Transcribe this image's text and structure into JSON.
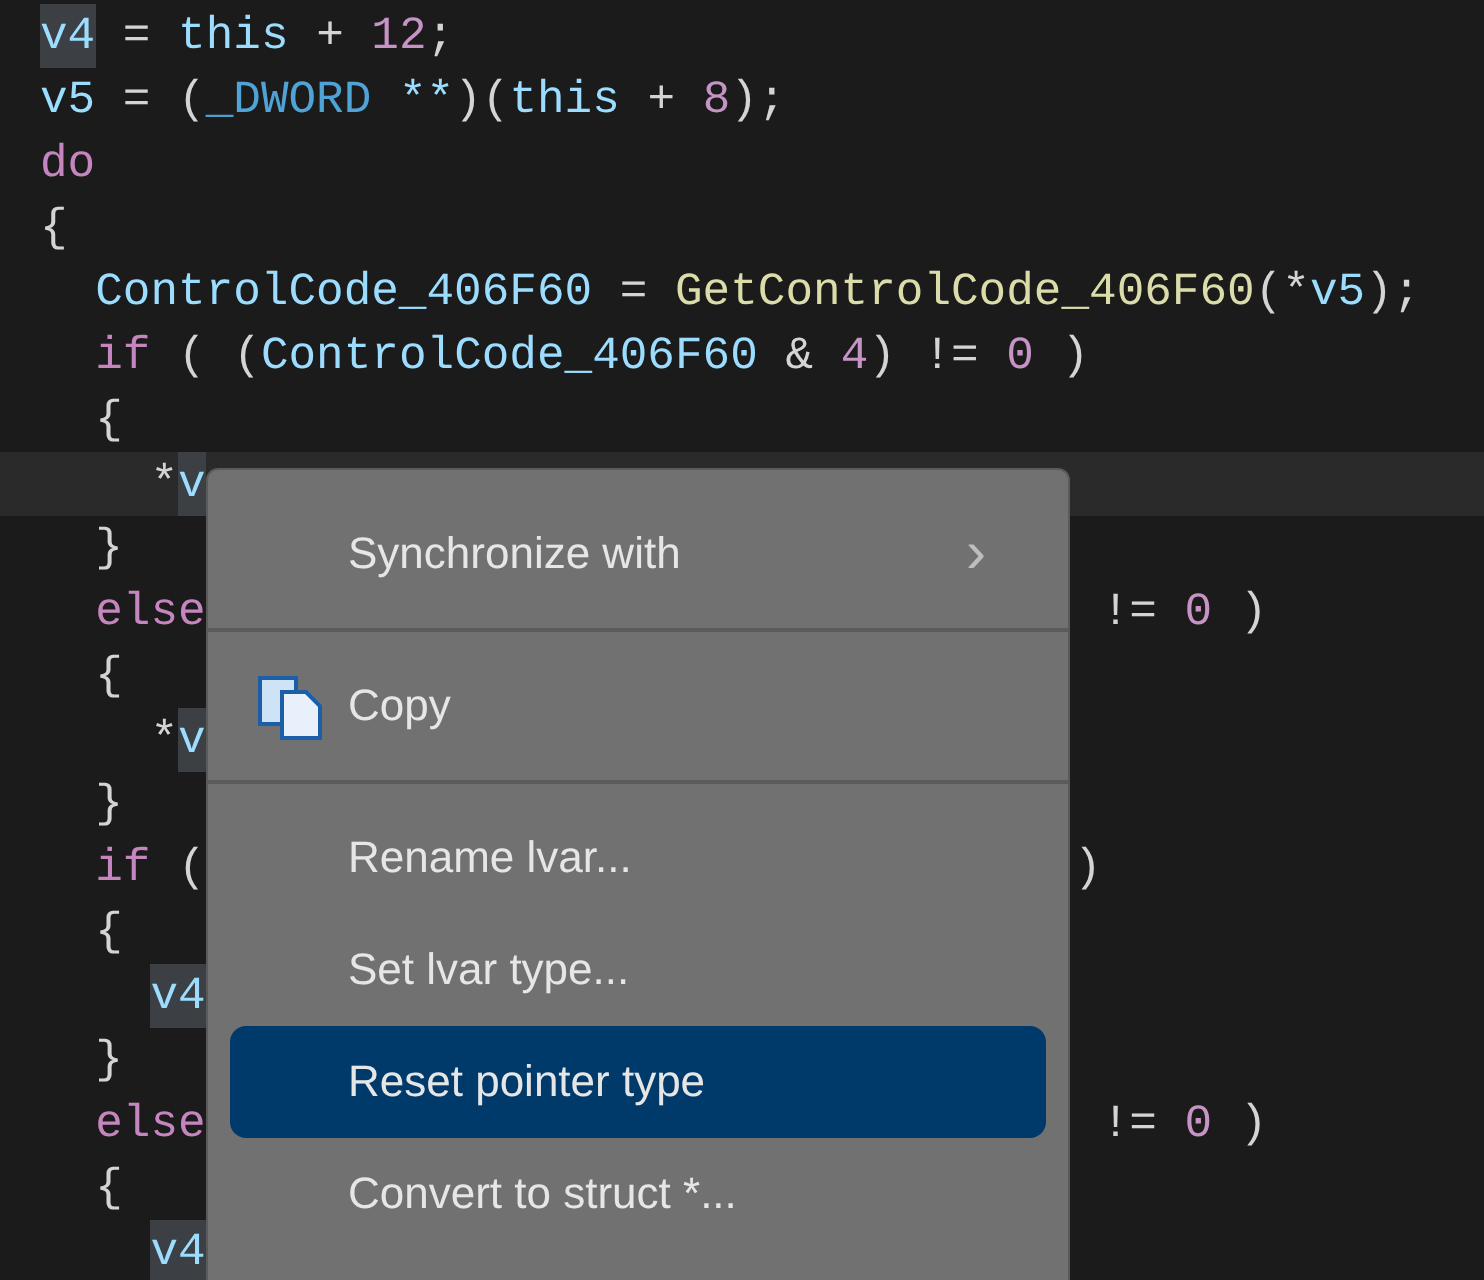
{
  "code_lines": [
    {
      "current": false,
      "before": [
        {
          "t": "v4",
          "kind": "ident",
          "highlighted": true
        },
        {
          "t": " = ",
          "kind": "punct"
        },
        {
          "t": "this",
          "kind": "ident"
        },
        {
          "t": " + ",
          "kind": "punct"
        },
        {
          "t": "12",
          "kind": "num"
        },
        {
          "t": ";",
          "kind": "punct"
        }
      ]
    },
    {
      "current": false,
      "before": [
        {
          "t": "v5",
          "kind": "ident"
        },
        {
          "t": " = (",
          "kind": "punct"
        },
        {
          "t": "_DWORD",
          "kind": "type"
        },
        {
          "t": " **",
          "kind": "ident"
        },
        {
          "t": ")(",
          "kind": "punct"
        },
        {
          "t": "this",
          "kind": "ident"
        },
        {
          "t": " + ",
          "kind": "punct"
        },
        {
          "t": "8",
          "kind": "num"
        },
        {
          "t": ");",
          "kind": "punct"
        }
      ]
    },
    {
      "current": false,
      "before": [
        {
          "t": "do",
          "kind": "kw"
        }
      ]
    },
    {
      "current": false,
      "before": [
        {
          "t": "{",
          "kind": "punct"
        }
      ]
    },
    {
      "current": false,
      "before": [
        {
          "t": "  ControlCode_406F60",
          "kind": "ident"
        },
        {
          "t": " = ",
          "kind": "punct"
        },
        {
          "t": "GetControlCode_406F60",
          "kind": "func"
        },
        {
          "t": "(*",
          "kind": "punct"
        },
        {
          "t": "v5",
          "kind": "ident"
        },
        {
          "t": ");",
          "kind": "punct"
        }
      ]
    },
    {
      "current": false,
      "before": [
        {
          "t": "  if",
          "kind": "kw"
        },
        {
          "t": " ( (",
          "kind": "punct"
        },
        {
          "t": "ControlCode_406F60",
          "kind": "ident"
        },
        {
          "t": " & ",
          "kind": "punct"
        },
        {
          "t": "4",
          "kind": "num"
        },
        {
          "t": ") != ",
          "kind": "punct"
        },
        {
          "t": "0",
          "kind": "num"
        },
        {
          "t": " )",
          "kind": "punct"
        }
      ]
    },
    {
      "current": false,
      "before": [
        {
          "t": "  {",
          "kind": "punct"
        }
      ]
    },
    {
      "current": true,
      "before": [
        {
          "t": "    *",
          "kind": "punct"
        },
        {
          "t": "v",
          "kind": "ident",
          "highlighted": true
        }
      ]
    },
    {
      "current": false,
      "before": [
        {
          "t": "  }",
          "kind": "punct"
        }
      ]
    },
    {
      "current": false,
      "before": [
        {
          "t": "  else",
          "kind": "kw"
        }
      ],
      "after": [
        {
          "t": " != ",
          "kind": "punct"
        },
        {
          "t": "0",
          "kind": "num"
        },
        {
          "t": " )",
          "kind": "punct"
        }
      ]
    },
    {
      "current": false,
      "before": [
        {
          "t": "  {",
          "kind": "punct"
        }
      ]
    },
    {
      "current": false,
      "before": [
        {
          "t": "    *",
          "kind": "punct"
        },
        {
          "t": "v",
          "kind": "ident",
          "highlighted": true
        }
      ]
    },
    {
      "current": false,
      "before": [
        {
          "t": "  }",
          "kind": "punct"
        }
      ]
    },
    {
      "current": false,
      "before": [
        {
          "t": "  if",
          "kind": "kw"
        },
        {
          "t": " (",
          "kind": "punct"
        }
      ],
      "after": [
        {
          "t": ")",
          "kind": "punct"
        }
      ]
    },
    {
      "current": false,
      "before": [
        {
          "t": "  {",
          "kind": "punct"
        }
      ]
    },
    {
      "current": false,
      "before": [
        {
          "t": "    v4",
          "kind": "ident",
          "highlighted": true
        }
      ]
    },
    {
      "current": false,
      "before": [
        {
          "t": "  }",
          "kind": "punct"
        }
      ]
    },
    {
      "current": false,
      "before": [
        {
          "t": "  else",
          "kind": "kw"
        }
      ],
      "after": [
        {
          "t": " != ",
          "kind": "punct"
        },
        {
          "t": "0",
          "kind": "num"
        },
        {
          "t": " )",
          "kind": "punct"
        }
      ]
    },
    {
      "current": false,
      "before": [
        {
          "t": "  {",
          "kind": "punct"
        }
      ]
    },
    {
      "current": false,
      "before": [
        {
          "t": "    v4",
          "kind": "ident",
          "highlighted": true
        }
      ]
    }
  ],
  "context_menu": {
    "items": [
      {
        "kind": "submenu",
        "label": "Synchronize with",
        "arrow": "›",
        "selected": false
      },
      {
        "kind": "separator"
      },
      {
        "kind": "copy",
        "label": "Copy",
        "selected": false
      },
      {
        "kind": "separator"
      },
      {
        "kind": "plain",
        "label": "Rename lvar...",
        "selected": false
      },
      {
        "kind": "plain",
        "label": "Set lvar type...",
        "selected": false
      },
      {
        "kind": "plain",
        "label": "Reset pointer type",
        "selected": true
      },
      {
        "kind": "plain",
        "label": "Convert to struct *...",
        "selected": false
      }
    ]
  }
}
